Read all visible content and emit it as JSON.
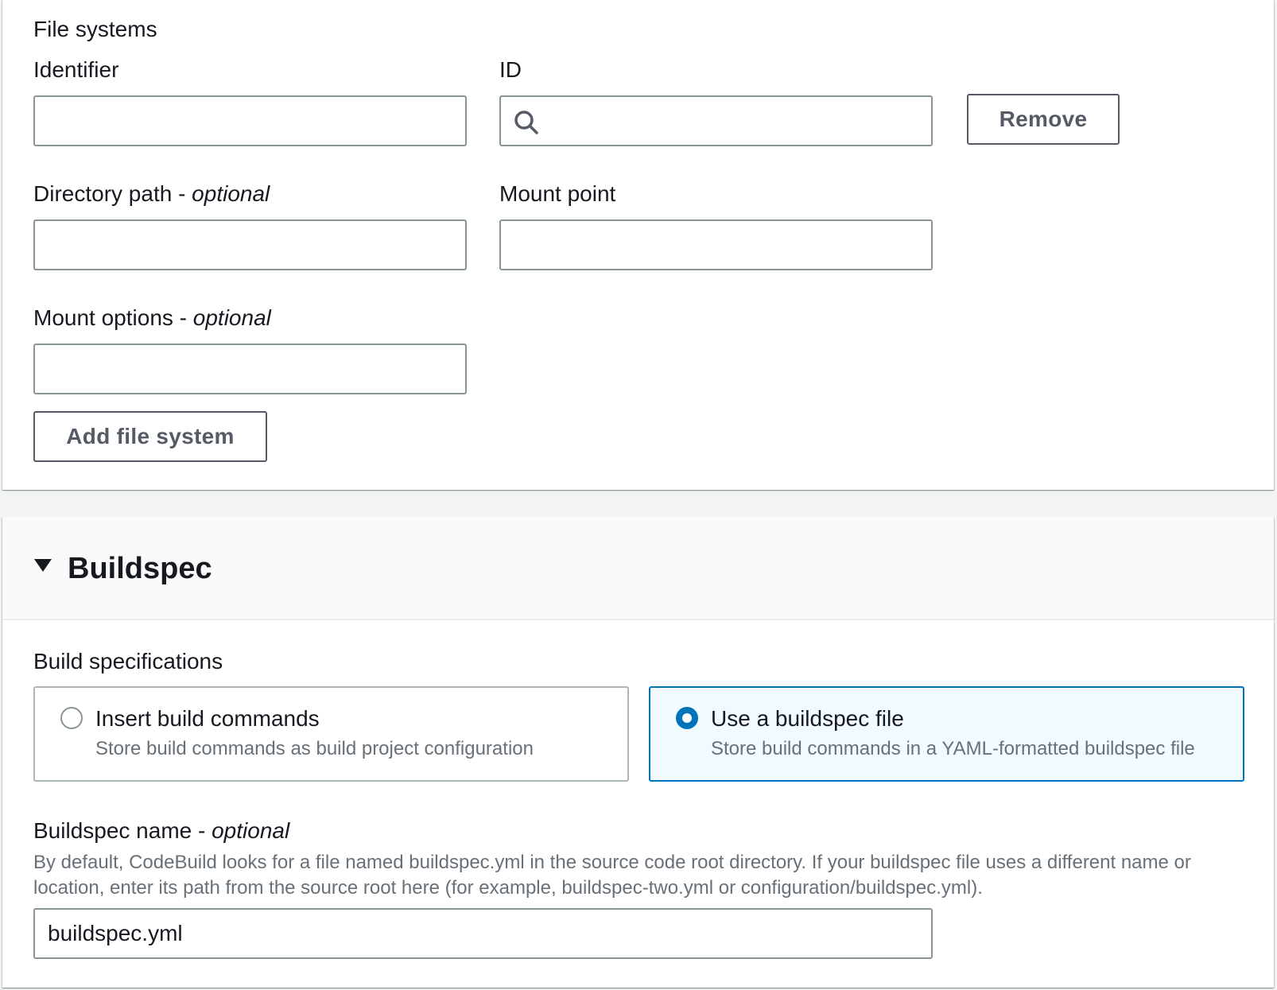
{
  "file_systems": {
    "section_label": "File systems",
    "identifier_label": "Identifier",
    "identifier_value": "",
    "id_label": "ID",
    "id_value": "",
    "remove_label": "Remove",
    "directory_path_label": "Directory path - ",
    "directory_path_optional": "optional",
    "directory_path_value": "",
    "mount_point_label": "Mount point",
    "mount_point_value": "",
    "mount_options_label": "Mount options - ",
    "mount_options_optional": "optional",
    "mount_options_value": "",
    "add_label": "Add file system"
  },
  "buildspec": {
    "heading": "Buildspec",
    "expanded": true,
    "specs_label": "Build specifications",
    "options": [
      {
        "title": "Insert build commands",
        "description": "Store build commands as build project configuration",
        "selected": false
      },
      {
        "title": "Use a buildspec file",
        "description": "Store build commands in a YAML-formatted buildspec file",
        "selected": true
      }
    ],
    "name_label": "Buildspec name - ",
    "name_optional": "optional",
    "name_description": "By default, CodeBuild looks for a file named buildspec.yml in the source code root directory. If your buildspec file uses a different name or location, enter its path from the source root here (for example, buildspec-two.yml or configuration/buildspec.yml).",
    "name_value": "buildspec.yml"
  },
  "colors": {
    "accent": "#0073bb",
    "selected_tile_bg": "#f1faff",
    "border": "#879596",
    "secondary_text": "#687078",
    "button_text": "#545b64"
  },
  "icons": {
    "search": "search-icon",
    "caret": "caret-down-icon"
  }
}
